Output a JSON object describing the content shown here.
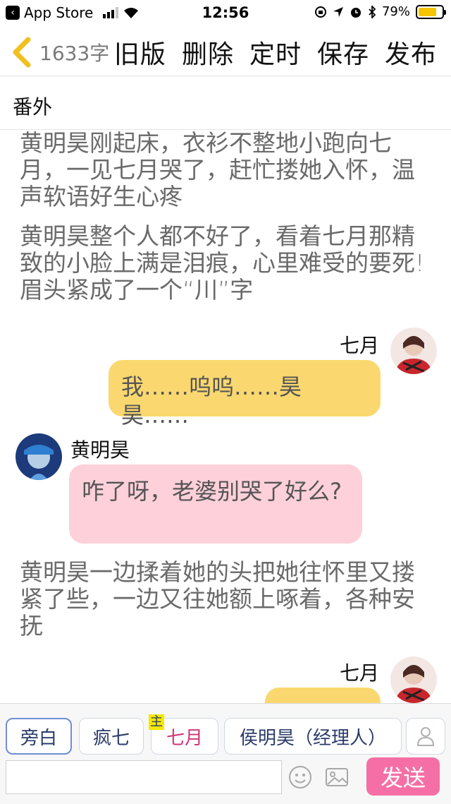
{
  "status_bar": {
    "back_app": "App Store",
    "time": "12:56",
    "battery": "79%",
    "battery_level": 0.79
  },
  "nav": {
    "word_count": "1633字",
    "actions": [
      "旧版",
      "删除",
      "定时",
      "保存",
      "发布"
    ]
  },
  "chapter_title": "番外",
  "content": {
    "narration1": "黄明昊刚起床，衣衫不整地小跑向七月，一见七月哭了，赶忙搂她入怀，温声软语好生心疼",
    "narration2": "黄明昊整个人都不好了，看着七月那精致的小脸上满是泪痕，心里难受的要死!眉头紧成了一个“川”字",
    "msg1_name": "七月",
    "msg1_text": "我……呜呜……昊昊……",
    "msg2_name": "黄明昊",
    "msg2_text": "咋了呀，老婆别哭了好么?",
    "narration3": "黄明昊一边揉着她的头把她往怀里又搂紧了些，一边又往她额上啄着，各种安抚",
    "msg3_name": "七月"
  },
  "bottom": {
    "roles": [
      "旁白",
      "疯七",
      "七月",
      "侯明昊（经理人）"
    ],
    "main_tag": "主",
    "input_value": "",
    "send_label": "发送"
  },
  "colors": {
    "yellow_bubble": "#fad86f",
    "pink_bubble": "#fdd0da",
    "send_button": "#f56fa6"
  }
}
